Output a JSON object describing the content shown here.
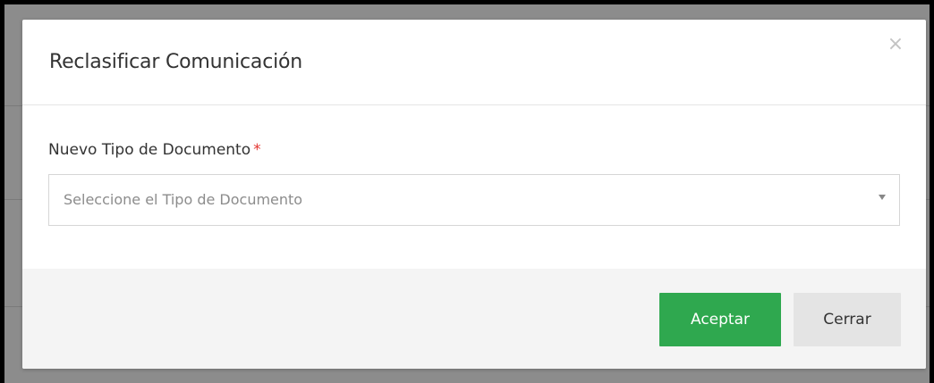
{
  "modal": {
    "title": "Reclasificar Comunicación",
    "close_symbol": "×",
    "field": {
      "label": "Nuevo Tipo de Documento",
      "required_mark": "*",
      "select_placeholder": "Seleccione el Tipo de Documento"
    },
    "buttons": {
      "accept_label": "Aceptar",
      "close_label": "Cerrar"
    }
  },
  "colors": {
    "accept_button": "#2fa84f",
    "close_button": "#e4e4e4",
    "required_mark": "#e3342f",
    "overlay": "#8c8c8c"
  },
  "icons": {
    "close": "close-icon",
    "dropdown": "chevron-down-icon"
  }
}
